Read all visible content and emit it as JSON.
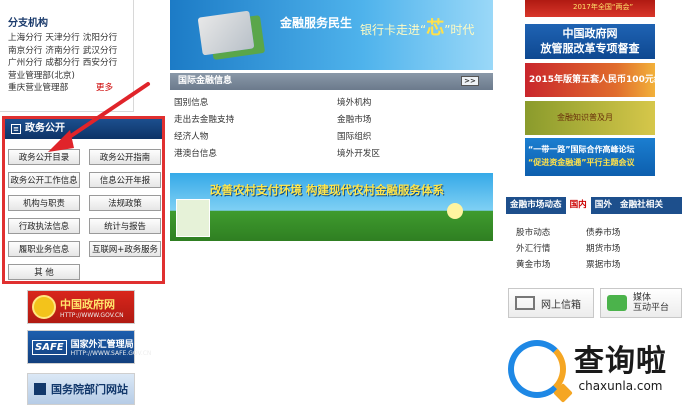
{
  "branch": {
    "title": "分支机构",
    "rows": [
      [
        "上海分行",
        "天津分行",
        "沈阳分行"
      ],
      [
        "南京分行",
        "济南分行",
        "武汉分行"
      ],
      [
        "广州分行",
        "成都分行",
        "西安分行"
      ],
      [
        "营业管理部(北京)"
      ],
      [
        "重庆营业管理部"
      ]
    ],
    "more": "更多"
  },
  "gov_open": {
    "title": "政务公开",
    "buttons": [
      "政务公开目录",
      "政务公开指南",
      "政务公开工作信息",
      "信息公开年报",
      "机构与职责",
      "法规政策",
      "行政执法信息",
      "统计与报告",
      "履职业务信息",
      "互联网+政务服务",
      "其    他"
    ]
  },
  "left_logos": {
    "gov": {
      "name": "中国政府网",
      "url": "HTTP://WWW.GOV.CN"
    },
    "safe": {
      "abbr": "SAFE",
      "name": "国家外汇管理局",
      "url": "HTTP://WWW.SAFE.GOV.CN"
    },
    "state": {
      "name": "国务院部门网站"
    }
  },
  "banner_top": {
    "text1": "金融服务民生",
    "text2_pre": "银行卡走进“",
    "text2_core": "芯",
    "text2_post": "”时代"
  },
  "intl": {
    "title": "国际金融信息",
    "more": ">>",
    "items": [
      "国别信息",
      "境外机构",
      "走出去金融支持",
      "金融市场",
      "经济人物",
      "国际组织",
      "港澳台信息",
      "境外开发区"
    ]
  },
  "banner_mid": {
    "text": "改善农村支付环境 构建现代农村金融服务体系"
  },
  "right_banners": {
    "r0": "2017年全国“两会”",
    "r1_line1": "中国政府网",
    "r1_line2": "放管服改革专项督查",
    "r2": "2015年版第五套人民币100元纸币",
    "r3": "金融知识普及月",
    "r4_line1": "“一带一路”国际合作高峰论坛",
    "r4_line2": "“促进资金融通”平行主题会议"
  },
  "market": {
    "tabs": [
      "金融市场动态",
      "国内",
      "国外",
      "金融社相关"
    ],
    "items": [
      "股市动态",
      "债券市场",
      "外汇行情",
      "期货市场",
      "黄金市场",
      "票据市场"
    ]
  },
  "buttons": {
    "mail": "网上信箱",
    "media_line1": "媒体",
    "media_line2": "互动平台"
  },
  "watermark": {
    "cn": "查询啦",
    "en": "chaxunla.com"
  },
  "colors": {
    "highlight": "#e03030",
    "nav_blue": "#1d4f8c",
    "active_tab": "#cc0000"
  }
}
